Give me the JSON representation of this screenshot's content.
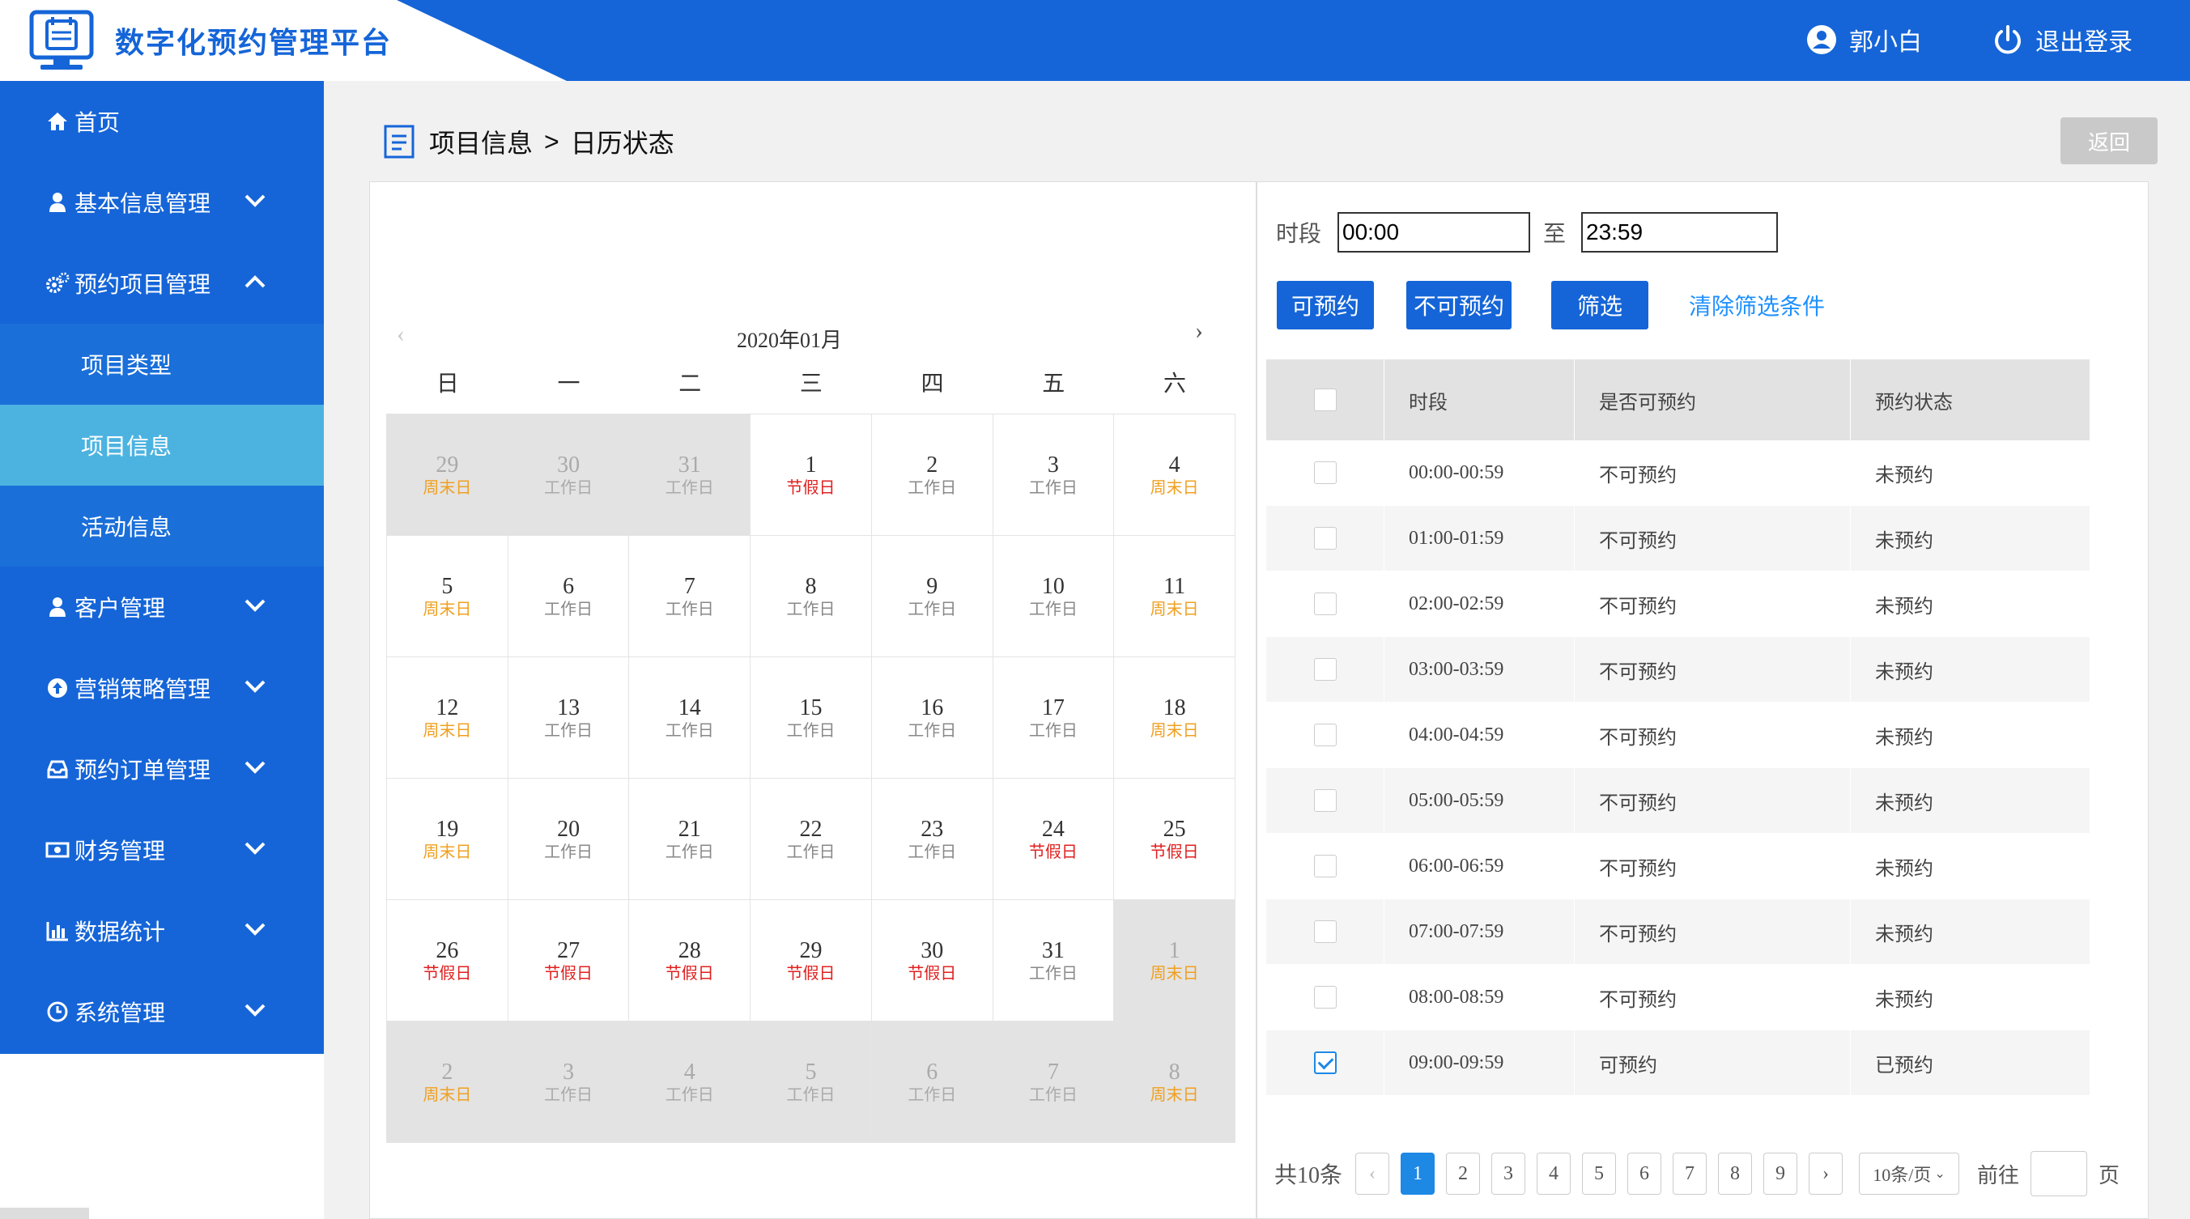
{
  "app": {
    "title": "数字化预约管理平台",
    "user_name": "郭小白",
    "logout_label": "退出登录"
  },
  "sidebar": {
    "items": [
      {
        "label": "首页",
        "icon": "home-icon"
      },
      {
        "label": "基本信息管理",
        "icon": "user-icon",
        "expanded": false
      },
      {
        "label": "预约项目管理",
        "icon": "gears-icon",
        "expanded": true
      },
      {
        "label": "客户管理",
        "icon": "user-icon",
        "expanded": false
      },
      {
        "label": "营销策略管理",
        "icon": "upload-circle-icon",
        "expanded": false
      },
      {
        "label": "预约订单管理",
        "icon": "inbox-icon",
        "expanded": false
      },
      {
        "label": "财务管理",
        "icon": "money-icon",
        "expanded": false
      },
      {
        "label": "数据统计",
        "icon": "bar-chart-icon",
        "expanded": false
      },
      {
        "label": "系统管理",
        "icon": "clock-icon",
        "expanded": false
      }
    ],
    "subitems": [
      {
        "label": "项目类型"
      },
      {
        "label": "项目信息",
        "active": true
      },
      {
        "label": "活动信息"
      }
    ]
  },
  "breadcrumb": {
    "parent": "项目信息",
    "separator": ">",
    "current": "日历状态"
  },
  "back_label": "返回",
  "calendar": {
    "title": "2020年01月",
    "weekdays": [
      "日",
      "一",
      "二",
      "三",
      "四",
      "五",
      "六"
    ],
    "days": [
      {
        "d": "29",
        "t": "周末日",
        "k": "weekend",
        "o": true
      },
      {
        "d": "30",
        "t": "工作日",
        "k": "work",
        "o": true
      },
      {
        "d": "31",
        "t": "工作日",
        "k": "work",
        "o": true
      },
      {
        "d": "1",
        "t": "节假日",
        "k": "holiday"
      },
      {
        "d": "2",
        "t": "工作日",
        "k": "work"
      },
      {
        "d": "3",
        "t": "工作日",
        "k": "work"
      },
      {
        "d": "4",
        "t": "周末日",
        "k": "weekend"
      },
      {
        "d": "5",
        "t": "周末日",
        "k": "weekend"
      },
      {
        "d": "6",
        "t": "工作日",
        "k": "work"
      },
      {
        "d": "7",
        "t": "工作日",
        "k": "work"
      },
      {
        "d": "8",
        "t": "工作日",
        "k": "work"
      },
      {
        "d": "9",
        "t": "工作日",
        "k": "work"
      },
      {
        "d": "10",
        "t": "工作日",
        "k": "work"
      },
      {
        "d": "11",
        "t": "周末日",
        "k": "weekend"
      },
      {
        "d": "12",
        "t": "周末日",
        "k": "weekend"
      },
      {
        "d": "13",
        "t": "工作日",
        "k": "work"
      },
      {
        "d": "14",
        "t": "工作日",
        "k": "work"
      },
      {
        "d": "15",
        "t": "工作日",
        "k": "work"
      },
      {
        "d": "16",
        "t": "工作日",
        "k": "work"
      },
      {
        "d": "17",
        "t": "工作日",
        "k": "work"
      },
      {
        "d": "18",
        "t": "周末日",
        "k": "weekend"
      },
      {
        "d": "19",
        "t": "周末日",
        "k": "weekend"
      },
      {
        "d": "20",
        "t": "工作日",
        "k": "work"
      },
      {
        "d": "21",
        "t": "工作日",
        "k": "work"
      },
      {
        "d": "22",
        "t": "工作日",
        "k": "work"
      },
      {
        "d": "23",
        "t": "工作日",
        "k": "work"
      },
      {
        "d": "24",
        "t": "节假日",
        "k": "holiday"
      },
      {
        "d": "25",
        "t": "节假日",
        "k": "holiday"
      },
      {
        "d": "26",
        "t": "节假日",
        "k": "holiday"
      },
      {
        "d": "27",
        "t": "节假日",
        "k": "holiday"
      },
      {
        "d": "28",
        "t": "节假日",
        "k": "holiday"
      },
      {
        "d": "29",
        "t": "节假日",
        "k": "holiday"
      },
      {
        "d": "30",
        "t": "节假日",
        "k": "holiday"
      },
      {
        "d": "31",
        "t": "工作日",
        "k": "work"
      },
      {
        "d": "1",
        "t": "周末日",
        "k": "weekend",
        "o": true
      },
      {
        "d": "2",
        "t": "周末日",
        "k": "weekend",
        "o": true
      },
      {
        "d": "3",
        "t": "工作日",
        "k": "work",
        "o": true
      },
      {
        "d": "4",
        "t": "工作日",
        "k": "work",
        "o": true
      },
      {
        "d": "5",
        "t": "工作日",
        "k": "work",
        "o": true
      },
      {
        "d": "6",
        "t": "工作日",
        "k": "work",
        "o": true
      },
      {
        "d": "7",
        "t": "工作日",
        "k": "work",
        "o": true
      },
      {
        "d": "8",
        "t": "周末日",
        "k": "weekend",
        "o": true
      }
    ]
  },
  "filter": {
    "time_label": "时段",
    "from_value": "00:00",
    "to_label": "至",
    "to_value": "23:59",
    "btn_available": "可预约",
    "btn_unavailable": "不可预约",
    "btn_filter": "筛选",
    "clear_label": "清除筛选条件"
  },
  "table": {
    "headers": [
      "时段",
      "是否可预约",
      "预约状态"
    ],
    "rows": [
      {
        "slot": "00:00-00:59",
        "avail": "不可预约",
        "status": "未预约",
        "checked": false
      },
      {
        "slot": "01:00-01:59",
        "avail": "不可预约",
        "status": "未预约",
        "checked": false
      },
      {
        "slot": "02:00-02:59",
        "avail": "不可预约",
        "status": "未预约",
        "checked": false
      },
      {
        "slot": "03:00-03:59",
        "avail": "不可预约",
        "status": "未预约",
        "checked": false
      },
      {
        "slot": "04:00-04:59",
        "avail": "不可预约",
        "status": "未预约",
        "checked": false
      },
      {
        "slot": "05:00-05:59",
        "avail": "不可预约",
        "status": "未预约",
        "checked": false
      },
      {
        "slot": "06:00-06:59",
        "avail": "不可预约",
        "status": "未预约",
        "checked": false
      },
      {
        "slot": "07:00-07:59",
        "avail": "不可预约",
        "status": "未预约",
        "checked": false
      },
      {
        "slot": "08:00-08:59",
        "avail": "不可预约",
        "status": "未预约",
        "checked": false
      },
      {
        "slot": "09:00-09:59",
        "avail": "可预约",
        "status": "已预约",
        "checked": true
      }
    ]
  },
  "pager": {
    "total_label": "共10条",
    "pages": [
      "1",
      "2",
      "3",
      "4",
      "5",
      "6",
      "7",
      "8",
      "9"
    ],
    "current": "1",
    "prev": "‹",
    "next": "›",
    "per_page": "10条/页",
    "goto_label": "前往",
    "page_unit": "页"
  },
  "colors": {
    "brand": "#1565d8",
    "active_sub": "#4cb3e0",
    "weekend": "#f0a020",
    "holiday": "#e02020",
    "link": "#1e90ff"
  }
}
